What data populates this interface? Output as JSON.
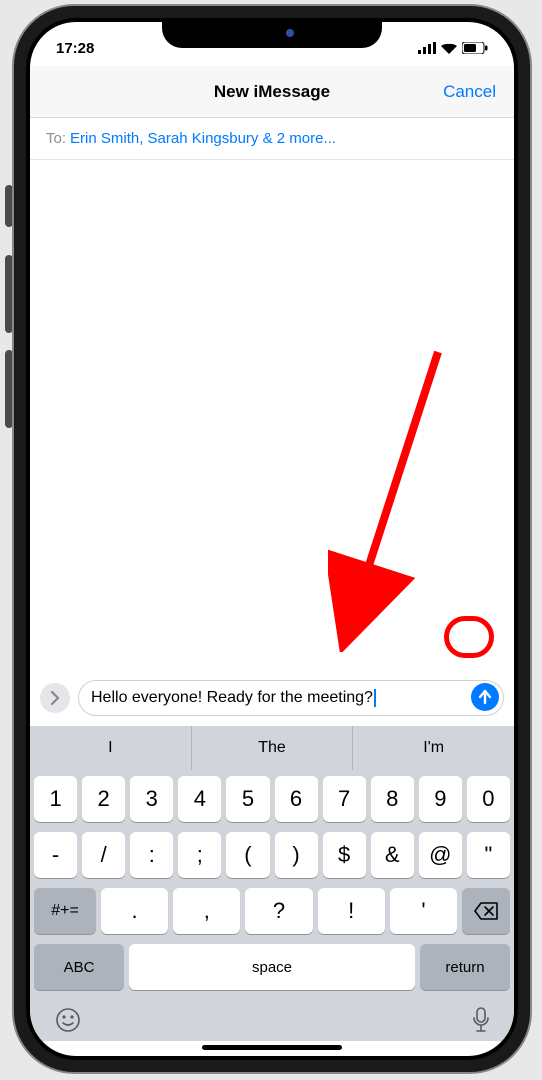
{
  "status": {
    "time": "17:28"
  },
  "header": {
    "title": "New iMessage",
    "cancel": "Cancel"
  },
  "recipients": {
    "label": "To:",
    "value": "Erin Smith, Sarah Kingsbury & 2 more..."
  },
  "compose": {
    "text": "Hello everyone! Ready for the meeting?"
  },
  "suggestions": [
    "I",
    "The",
    "I'm"
  ],
  "keyboard": {
    "row1": [
      "1",
      "2",
      "3",
      "4",
      "5",
      "6",
      "7",
      "8",
      "9",
      "0"
    ],
    "row2": [
      "-",
      "/",
      ":",
      ";",
      "(",
      ")",
      "$",
      "&",
      "@",
      "\""
    ],
    "row3_shift": "#+=",
    "row3_mid": [
      ".",
      ",",
      "?",
      "!",
      "'"
    ],
    "row4": {
      "abc": "ABC",
      "space": "space",
      "ret": "return"
    }
  }
}
